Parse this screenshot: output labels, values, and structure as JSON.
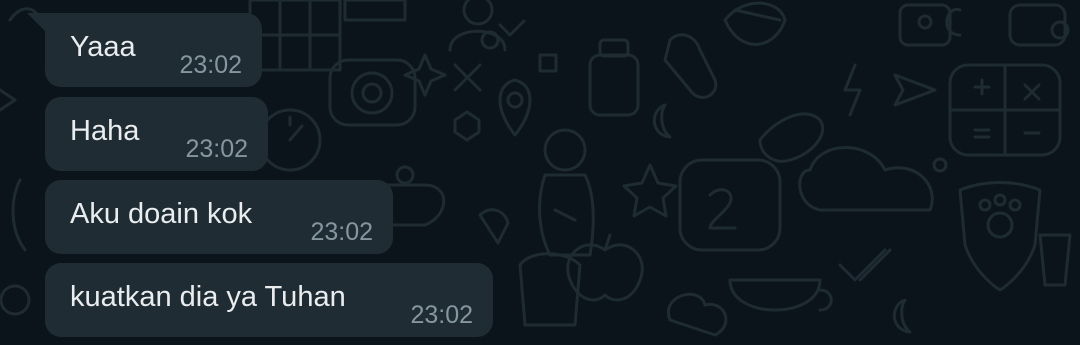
{
  "messages": [
    {
      "text": "Yaaa",
      "time": "23:02"
    },
    {
      "text": "Haha",
      "time": "23:02"
    },
    {
      "text": "Aku doain kok",
      "time": "23:02"
    },
    {
      "text": "kuatkan dia ya Tuhan",
      "time": "23:02"
    }
  ],
  "colors": {
    "background": "#0b141a",
    "bubble": "#202c33",
    "text": "#e9edef",
    "time": "#8696a0",
    "doodle": "#1c2930"
  }
}
